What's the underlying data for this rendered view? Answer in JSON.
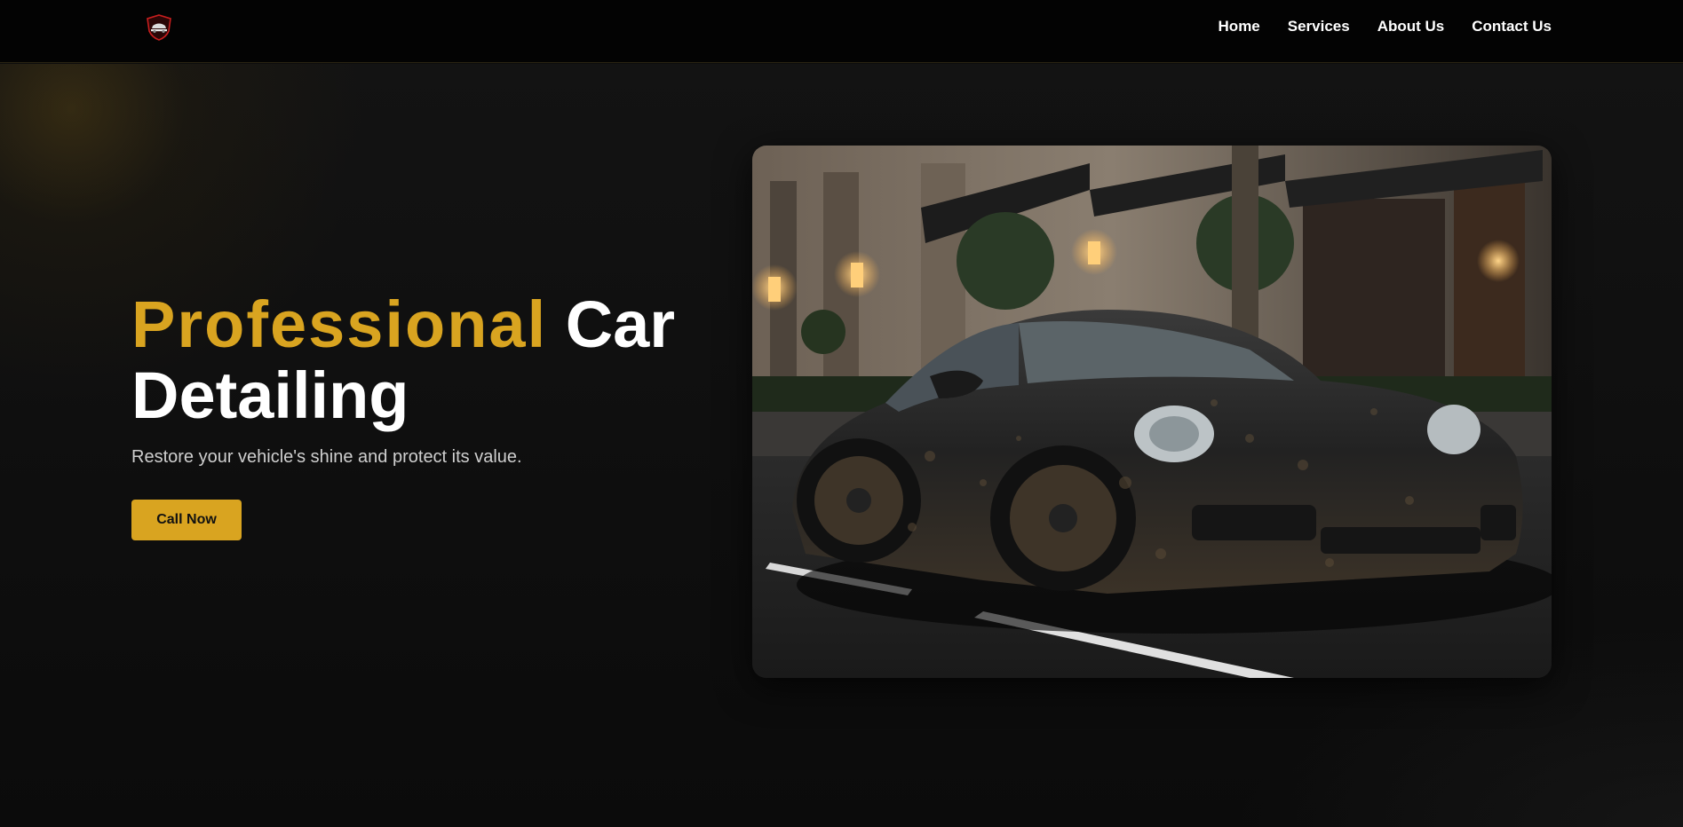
{
  "navbar": {
    "logo_alt": "Logo",
    "links": [
      {
        "label": "Home"
      },
      {
        "label": "Services"
      },
      {
        "label": "About Us"
      },
      {
        "label": "Contact Us"
      }
    ]
  },
  "hero": {
    "headline_accent": "Professional",
    "headline_rest": " Car Detailing",
    "subtitle": "Restore your vehicle's shine and protect its value.",
    "cta_label": "Call Now",
    "image_alt": "Muddy black sports car parked on a city street"
  },
  "colors": {
    "accent": "#d9a420",
    "background": "#0d0d0d",
    "navbar": "#030303",
    "text": "#ffffff",
    "subtext": "#cfcfcf"
  }
}
